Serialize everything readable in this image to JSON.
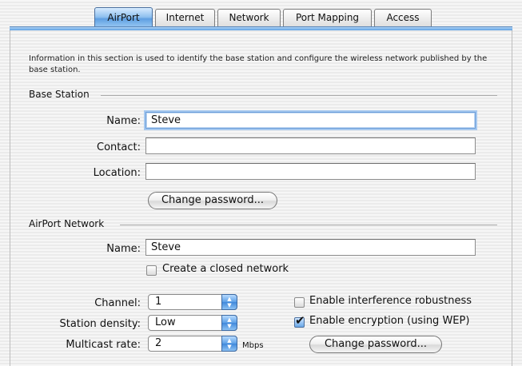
{
  "tabs": [
    {
      "label": "AirPort",
      "active": true
    },
    {
      "label": "Internet",
      "active": false
    },
    {
      "label": "Network",
      "active": false
    },
    {
      "label": "Port Mapping",
      "active": false
    },
    {
      "label": "Access",
      "active": false
    }
  ],
  "info_text": "Information in this section is used to identify the base station and configure the wireless network published by the base station.",
  "base_station": {
    "title": "Base Station",
    "name_label": "Name:",
    "name_value": "Steve",
    "contact_label": "Contact:",
    "contact_value": "",
    "location_label": "Location:",
    "location_value": "",
    "change_password_label": "Change password..."
  },
  "airport_network": {
    "title": "AirPort Network",
    "name_label": "Name:",
    "name_value": "Steve",
    "closed_network_label": "Create a closed network",
    "closed_network_checked": false,
    "channel_label": "Channel:",
    "channel_value": "1",
    "density_label": "Station density:",
    "density_value": "Low",
    "multicast_label": "Multicast rate:",
    "multicast_value": "2",
    "multicast_unit": "Mbps",
    "interference_label": "Enable interference robustness",
    "interference_checked": false,
    "encryption_label": "Enable encryption (using WEP)",
    "encryption_checked": true,
    "change_password_label": "Change password..."
  },
  "colors": {
    "accent": "#5f9fe2",
    "focus_ring": "#a6c8ef"
  },
  "icons": {
    "popup_arrows": "updown-arrows-icon",
    "checkmark": "checkmark-icon"
  }
}
